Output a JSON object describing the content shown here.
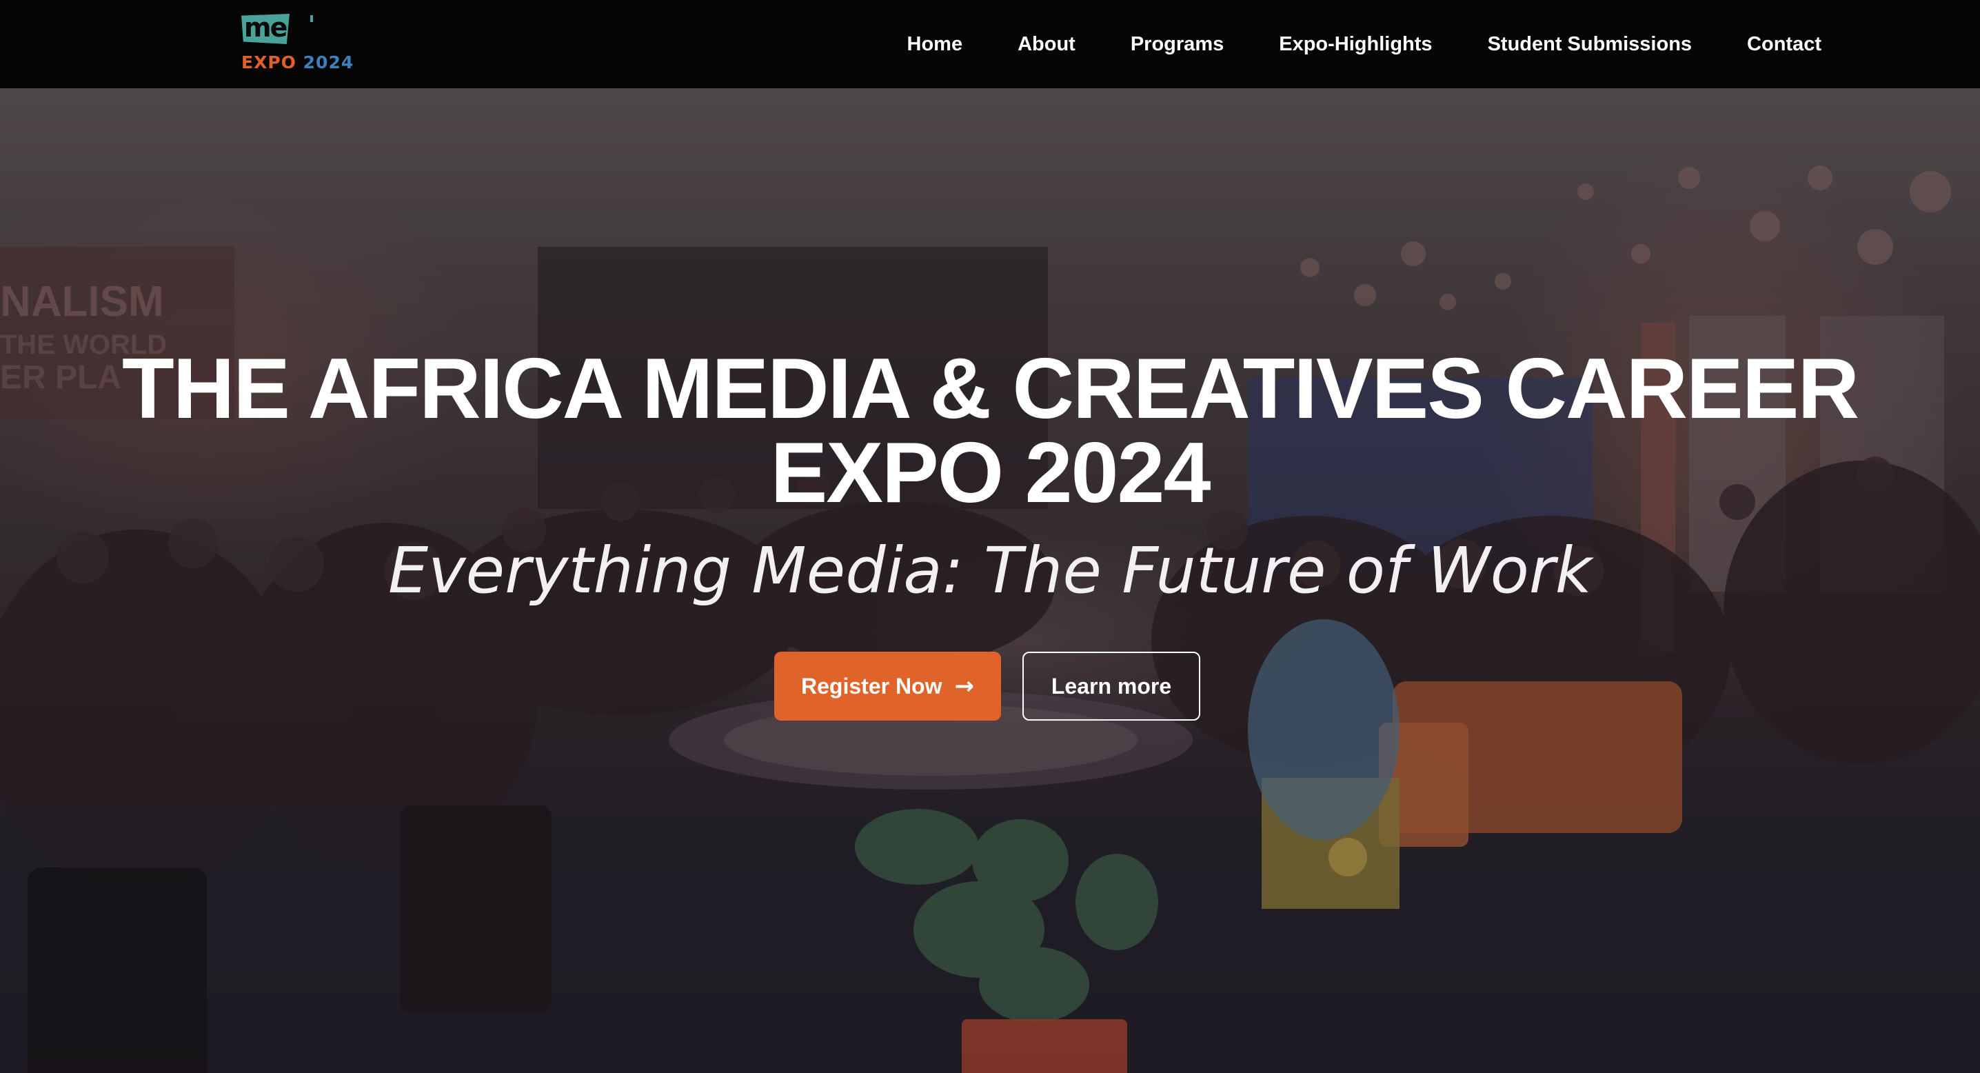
{
  "logo": {
    "mark": "me",
    "expo_word": "EXPO",
    "expo_year": "2024",
    "colors": {
      "teal": "#4aa39a",
      "orange": "#e0622a",
      "blue": "#3e7fbf"
    }
  },
  "nav": {
    "items": [
      {
        "label": "Home"
      },
      {
        "label": "About"
      },
      {
        "label": "Programs"
      },
      {
        "label": "Expo-Highlights"
      },
      {
        "label": "Student Submissions"
      },
      {
        "label": "Contact"
      }
    ]
  },
  "hero": {
    "title_line1": "THE AFRICA MEDIA & CREATIVES CAREER",
    "title_line2": "EXPO 2024",
    "subtitle": "Everything Media: The Future of Work",
    "register_label": "Register Now",
    "register_icon": "arrow-right-icon",
    "learn_label": "Learn more",
    "background_image": "conference-audience-photo",
    "backdrop_banner_text": "NALISM THE WORLD ER PLA"
  },
  "colors": {
    "navbar_bg": "#050505",
    "accent": "#e0642a",
    "text": "#ffffff"
  }
}
